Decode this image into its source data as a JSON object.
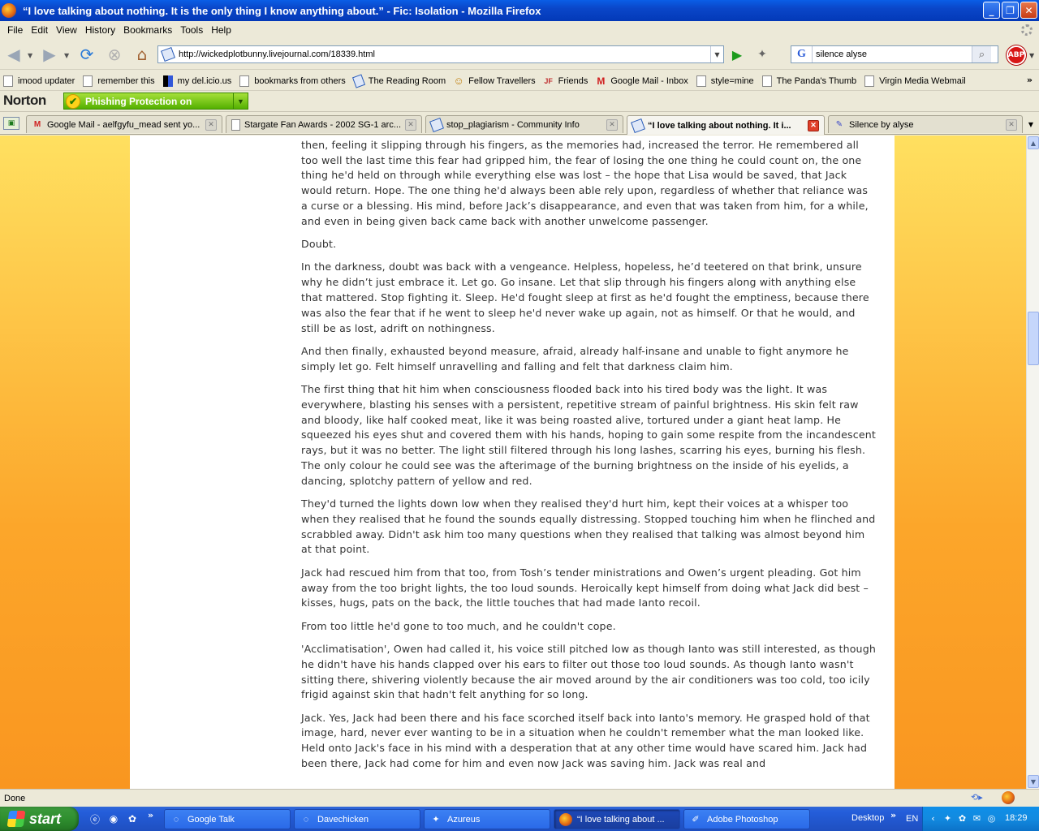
{
  "window": {
    "title": "“I love talking about nothing. It is the only thing I know anything about.” - Fic: Isolation - Mozilla Firefox",
    "minimize": "_",
    "maximize": "❐",
    "close": "✕"
  },
  "menu": [
    "File",
    "Edit",
    "View",
    "History",
    "Bookmarks",
    "Tools",
    "Help"
  ],
  "nav": {
    "url": "http://wickedplotbunny.livejournal.com/18339.html",
    "search_value": "silence alyse",
    "search_engine": "G",
    "adblock_label": "ABP"
  },
  "bookmarks": [
    {
      "label": "imood updater",
      "icon": "page-icon"
    },
    {
      "label": "remember this",
      "icon": "page-icon"
    },
    {
      "label": "my del.icio.us",
      "icon": "delicious-icon"
    },
    {
      "label": "bookmarks from others",
      "icon": "page-icon"
    },
    {
      "label": "The Reading Room",
      "icon": "livejournal-icon"
    },
    {
      "label": "Fellow Travellers",
      "icon": "livejournal-icon"
    },
    {
      "label": "Friends",
      "icon": "livejournal-icon"
    },
    {
      "label": "Google Mail - Inbox",
      "icon": "gmail-icon"
    },
    {
      "label": "style=mine",
      "icon": "page-icon"
    },
    {
      "label": "The Panda's Thumb",
      "icon": "page-icon"
    },
    {
      "label": "Virgin Media Webmail",
      "icon": "page-icon"
    }
  ],
  "norton": {
    "logo": "Norton",
    "status": "Phishing Protection on"
  },
  "tabs": [
    {
      "label": "Google Mail - aelfgyfu_mead sent yo...",
      "icon": "gmail-icon"
    },
    {
      "label": "Stargate Fan Awards - 2002 SG-1 arc...",
      "icon": "page-icon"
    },
    {
      "label": "stop_plagiarism - Community Info",
      "icon": "livejournal-icon"
    },
    {
      "label": "“I love talking about nothing. It i...",
      "icon": "livejournal-icon"
    },
    {
      "label": "Silence by alyse",
      "icon": "pen-icon"
    }
  ],
  "story": {
    "paragraphs": [
      "That was another hair's grip of sanity had started to slip too. The last he'd know, he'd have thought it before then, feeling it slipping through his fingers, as the memories had, increased the terror. He remembered all too well the last time this fear had gripped him, the fear of losing the one thing he could count on, the one thing he'd held on through while everything else was lost – the hope that Lisa would be saved, that Jack would return. Hope. The one thing he'd always been able rely upon, regardless of whether that reliance was a curse or a blessing. His mind, before Jack’s disappearance, and even that was taken from him, for a while, and even in being given back came back with another unwelcome passenger.",
      "Doubt.",
      "In the darkness, doubt was back with a vengeance. Helpless, hopeless, he’d teetered on that brink, unsure why he didn’t just embrace it. Let go. Go insane. Let that slip through his fingers along with anything else that mattered. Stop fighting it. Sleep. He'd fought sleep at first as he'd fought the emptiness, because there was also the fear that if he went to sleep he'd never wake up again, not as himself. Or that he would, and still be as lost, adrift on nothingness.",
      "And then finally, exhausted beyond measure, afraid, already half-insane and unable to fight anymore he simply let go. Felt himself unravelling and falling and felt that darkness claim him.",
      "The first thing that hit him when consciousness flooded back into his tired body was the light. It was everywhere, blasting his senses with a persistent, repetitive stream of painful brightness. His skin felt raw and bloody, like half cooked meat, like it was being roasted alive, tortured under a giant heat lamp. He squeezed his eyes shut and covered them with his hands, hoping to gain some respite from the incandescent rays, but it was no better. The light still filtered through his long lashes, scarring his eyes, burning his flesh. The only colour he could see was the afterimage of the burning brightness on the inside of his eyelids, a dancing, splotchy pattern of yellow and red.",
      "They'd turned the lights down low when they realised they'd hurt him, kept their voices at a whisper too when they realised that he found the sounds equally distressing. Stopped touching him when he flinched and scrabbled away. Didn't ask him too many questions when they realised that talking was almost beyond him at that point.",
      "Jack had rescued him from that too, from Tosh’s tender ministrations and Owen’s urgent pleading. Got him away from the too bright lights, the too loud sounds. Heroically kept himself from doing what Jack did best – kisses, hugs, pats on the back, the little touches that had made Ianto recoil.",
      "From too little he'd gone to too much, and he couldn't cope.",
      "'Acclimatisation', Owen had called it, his voice still pitched low as though Ianto was still interested, as though he didn't have his hands clapped over his ears to filter out those too loud sounds. As though Ianto wasn't sitting there, shivering violently because the air moved around by the air conditioners was too cold, too icily frigid against skin that hadn't felt anything for so long.",
      "Jack. Yes, Jack had been there and his face scorched itself back into Ianto's memory. He grasped hold of that image, hard, never ever wanting to be in a situation when he couldn't remember what the man looked like. Held onto Jack's face in his mind with a desperation that at any other time would have scared him. Jack had been there, Jack had come for him and even now Jack was saving him. Jack was real and"
    ]
  },
  "status": {
    "text": "Done"
  },
  "taskbar": {
    "start_label": "start",
    "tasks": [
      {
        "label": "Google Talk",
        "icon": "chat-icon"
      },
      {
        "label": "Davechicken",
        "icon": "chat-icon"
      },
      {
        "label": "Azureus",
        "icon": "frog-icon"
      },
      {
        "label": "“I love talking about ...",
        "icon": "firefox-icon"
      },
      {
        "label": "Adobe Photoshop",
        "icon": "photoshop-icon"
      }
    ],
    "desktop_label": "Desktop",
    "language": "EN",
    "clock": "18:29",
    "more": "»"
  },
  "colors": {
    "title_bar": "#0a46c8",
    "page_background": "#fca62a",
    "norton_green": "#54b000",
    "taskbar": "#245edb",
    "start_green": "#2f8f2f"
  }
}
